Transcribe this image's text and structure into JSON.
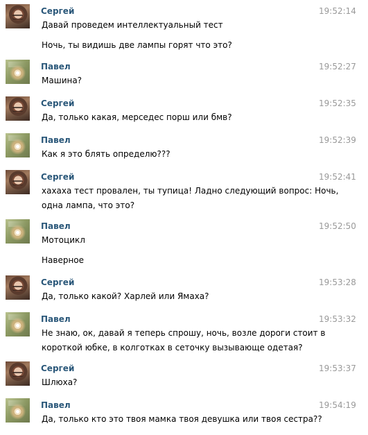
{
  "messages": [
    {
      "sender": "Сергей",
      "time": "19:52:14",
      "avatar": "sergey-avatar",
      "lines": [
        "Давай проведем интеллектуальный тест"
      ],
      "lines2": [
        "Ночь, ты видишь две лампы горят что это?"
      ]
    },
    {
      "sender": "Павел",
      "time": "19:52:27",
      "avatar": "pavel-avatar",
      "lines": [
        "Машина?"
      ]
    },
    {
      "sender": "Сергей",
      "time": "19:52:35",
      "avatar": "sergey-avatar",
      "lines": [
        "Да, только какая, мерседес порш или бмв?"
      ]
    },
    {
      "sender": "Павел",
      "time": "19:52:39",
      "avatar": "pavel-avatar",
      "lines": [
        "Как я это блять определю???"
      ]
    },
    {
      "sender": "Сергей",
      "time": "19:52:41",
      "avatar": "sergey-avatar",
      "lines": [
        "хахаха тест провален, ты тупица! Ладно следующий вопрос: Ночь,",
        "одна лампа, что это?"
      ]
    },
    {
      "sender": "Павел",
      "time": "19:52:50",
      "avatar": "pavel-avatar",
      "lines": [
        "Мотоцикл"
      ],
      "lines2": [
        "Наверное"
      ]
    },
    {
      "sender": "Сергей",
      "time": "19:53:28",
      "avatar": "sergey-avatar",
      "lines": [
        "Да, только какой? Харлей или Ямаха?"
      ]
    },
    {
      "sender": "Павел",
      "time": "19:53:32",
      "avatar": "pavel-avatar",
      "lines": [
        "Не знаю, ок, давай я теперь спрошу, ночь, возле дороги стоит в",
        "короткой юбке, в колготках в сеточку вызывающе одетая?"
      ]
    },
    {
      "sender": "Сергей",
      "time": "19:53:37",
      "avatar": "sergey-avatar",
      "lines": [
        "Шлюха?"
      ]
    },
    {
      "sender": "Павел",
      "time": "19:54:19",
      "avatar": "pavel-avatar",
      "lines": [
        "Да, только кто это твоя мамка твоя девушка или твоя сестра??"
      ]
    }
  ]
}
